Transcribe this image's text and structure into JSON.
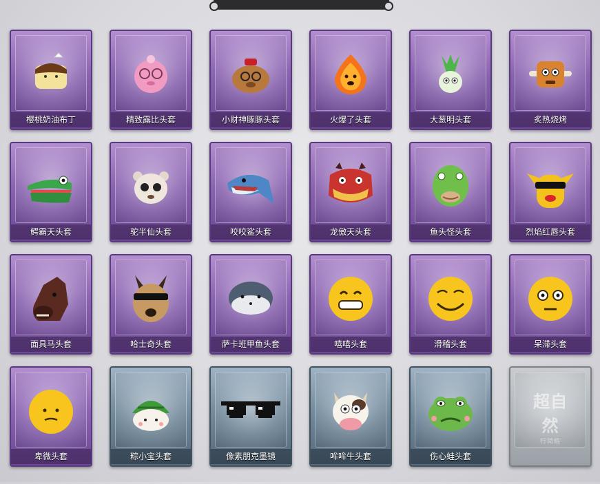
{
  "items": [
    {
      "label": "樱桃奶油布丁",
      "icon": "pudding-icon",
      "rarity": "purple"
    },
    {
      "label": "精致露比头套",
      "icon": "pink-pig-icon",
      "rarity": "purple"
    },
    {
      "label": "小财神豚豚头套",
      "icon": "capybara-icon",
      "rarity": "purple"
    },
    {
      "label": "火爆了头套",
      "icon": "fire-icon",
      "rarity": "purple"
    },
    {
      "label": "大葱明头套",
      "icon": "green-onion-icon",
      "rarity": "purple"
    },
    {
      "label": "炙热烧烤",
      "icon": "bbq-icon",
      "rarity": "purple"
    },
    {
      "label": "鳄霸天头套",
      "icon": "crocodile-icon",
      "rarity": "purple"
    },
    {
      "label": "驼半仙头套",
      "icon": "alpaca-icon",
      "rarity": "purple"
    },
    {
      "label": "咬咬鲨头套",
      "icon": "shark-icon",
      "rarity": "purple"
    },
    {
      "label": "龙傲天头套",
      "icon": "dragon-icon",
      "rarity": "purple"
    },
    {
      "label": "鱼头怪头套",
      "icon": "fish-head-icon",
      "rarity": "purple"
    },
    {
      "label": "烈焰红唇头套",
      "icon": "yellow-mask-icon",
      "rarity": "purple"
    },
    {
      "label": "面具马头套",
      "icon": "horse-icon",
      "rarity": "purple"
    },
    {
      "label": "哈士奇头套",
      "icon": "husky-icon",
      "rarity": "purple"
    },
    {
      "label": "萨卡班甲鱼头套",
      "icon": "sacabambaspis-icon",
      "rarity": "purple"
    },
    {
      "label": "嘻嘻头套",
      "icon": "grin-emoji-icon",
      "rarity": "purple"
    },
    {
      "label": "滑稽头套",
      "icon": "funny-emoji-icon",
      "rarity": "purple"
    },
    {
      "label": "呆滞头套",
      "icon": "dazed-emoji-icon",
      "rarity": "purple"
    },
    {
      "label": "卑微头套",
      "icon": "humble-emoji-icon",
      "rarity": "purple"
    },
    {
      "label": "粽小宝头套",
      "icon": "zongzi-icon",
      "rarity": "blue"
    },
    {
      "label": "像素朋克墨镜",
      "icon": "pixel-sunglasses-icon",
      "rarity": "blue"
    },
    {
      "label": "哞哞牛头套",
      "icon": "cow-icon",
      "rarity": "blue"
    },
    {
      "label": "伤心蛙头套",
      "icon": "sad-frog-icon",
      "rarity": "blue"
    },
    {
      "label": "",
      "icon": "watermark-logo",
      "rarity": "gray",
      "watermark": "超自然",
      "watermark_sub": "行动组"
    }
  ]
}
